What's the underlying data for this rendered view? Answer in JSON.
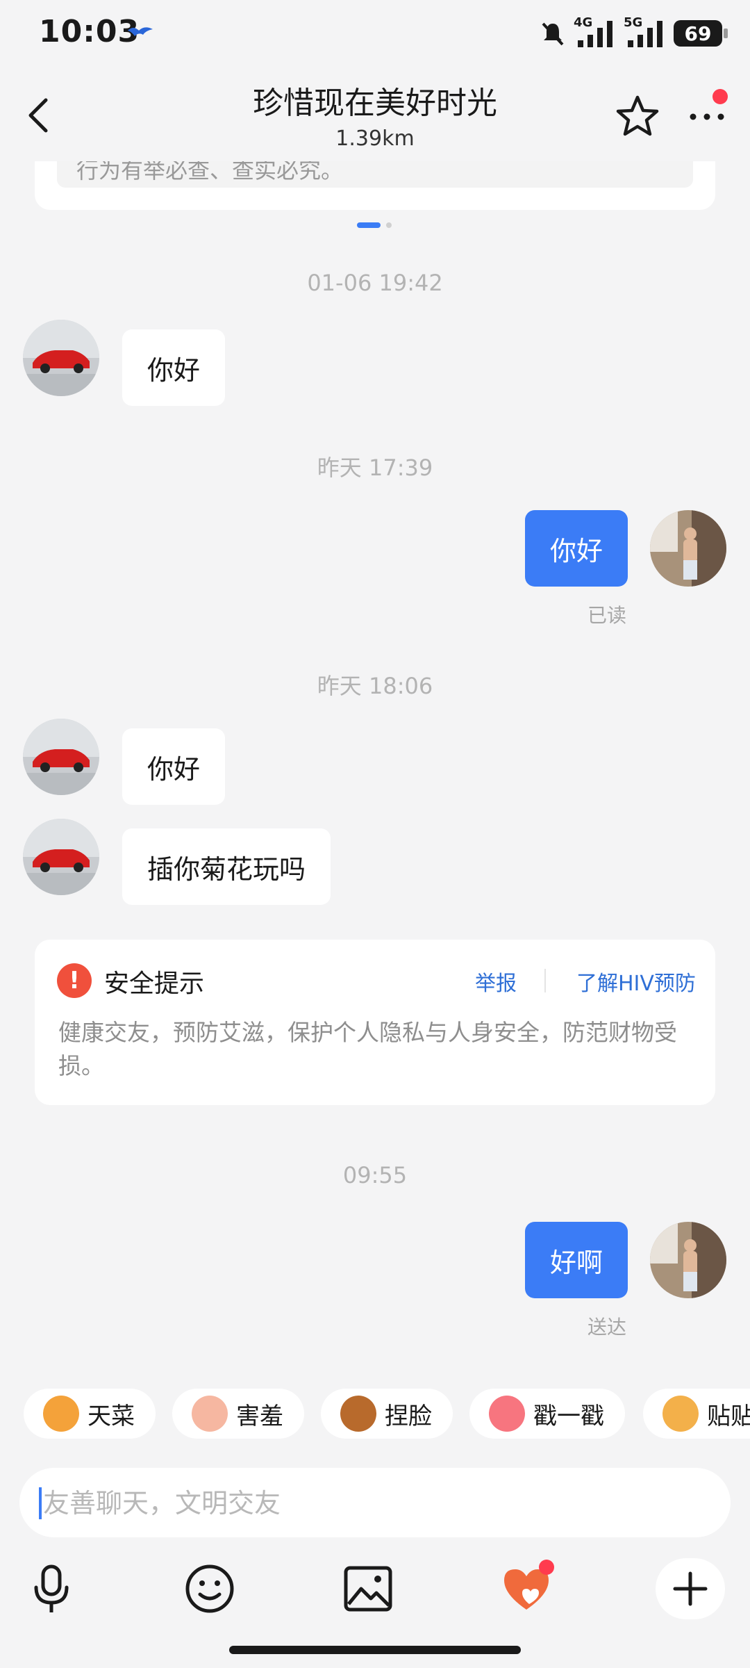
{
  "status_bar": {
    "time": "10:03",
    "network_1": "4G",
    "network_2": "5G",
    "battery": "69"
  },
  "header": {
    "title": "珍惜现在美好时光",
    "distance": "1.39km"
  },
  "top_card": {
    "text": "行为有举必查、查实必究。"
  },
  "messages": [
    {
      "type": "timestamp",
      "text": "01-06 19:42"
    },
    {
      "type": "incoming",
      "text": "你好"
    },
    {
      "type": "timestamp",
      "text": "昨天 17:39"
    },
    {
      "type": "outgoing",
      "text": "你好",
      "status": "已读"
    },
    {
      "type": "timestamp",
      "text": "昨天 18:06"
    },
    {
      "type": "incoming",
      "text": "你好"
    },
    {
      "type": "incoming",
      "text": "插你菊花玩吗"
    },
    {
      "type": "timestamp",
      "text": "09:55"
    },
    {
      "type": "outgoing",
      "text": "好啊",
      "status": "送达"
    }
  ],
  "safety_tip": {
    "title": "安全提示",
    "report": "举报",
    "hiv_link": "了解HIV预防",
    "body": "健康交友，预防艾滋，保护个人隐私与人身安全，防范财物受损。"
  },
  "quick_reactions": [
    {
      "label": "天菜",
      "icon": "corgi-emoji",
      "color": "#f4a23a"
    },
    {
      "label": "害羞",
      "icon": "shy-emoji",
      "color": "#f6b7a1"
    },
    {
      "label": "捏脸",
      "icon": "bear-emoji",
      "color": "#b86a2c"
    },
    {
      "label": "戳一戳",
      "icon": "peach-emoji",
      "color": "#f7757f"
    },
    {
      "label": "贴贴",
      "icon": "hug-emoji",
      "color": "#f3b04a"
    }
  ],
  "input": {
    "placeholder": "友善聊天，文明交友"
  },
  "toolbar": {
    "icons": [
      "mic-icon",
      "emoji-icon",
      "image-icon",
      "heart-icon",
      "plus-icon"
    ]
  },
  "colors": {
    "accent": "#3b7cf6",
    "background": "#f4f4f5",
    "link": "#2f6fd6",
    "warning": "#f0503c",
    "badge": "#ff3b4e"
  }
}
